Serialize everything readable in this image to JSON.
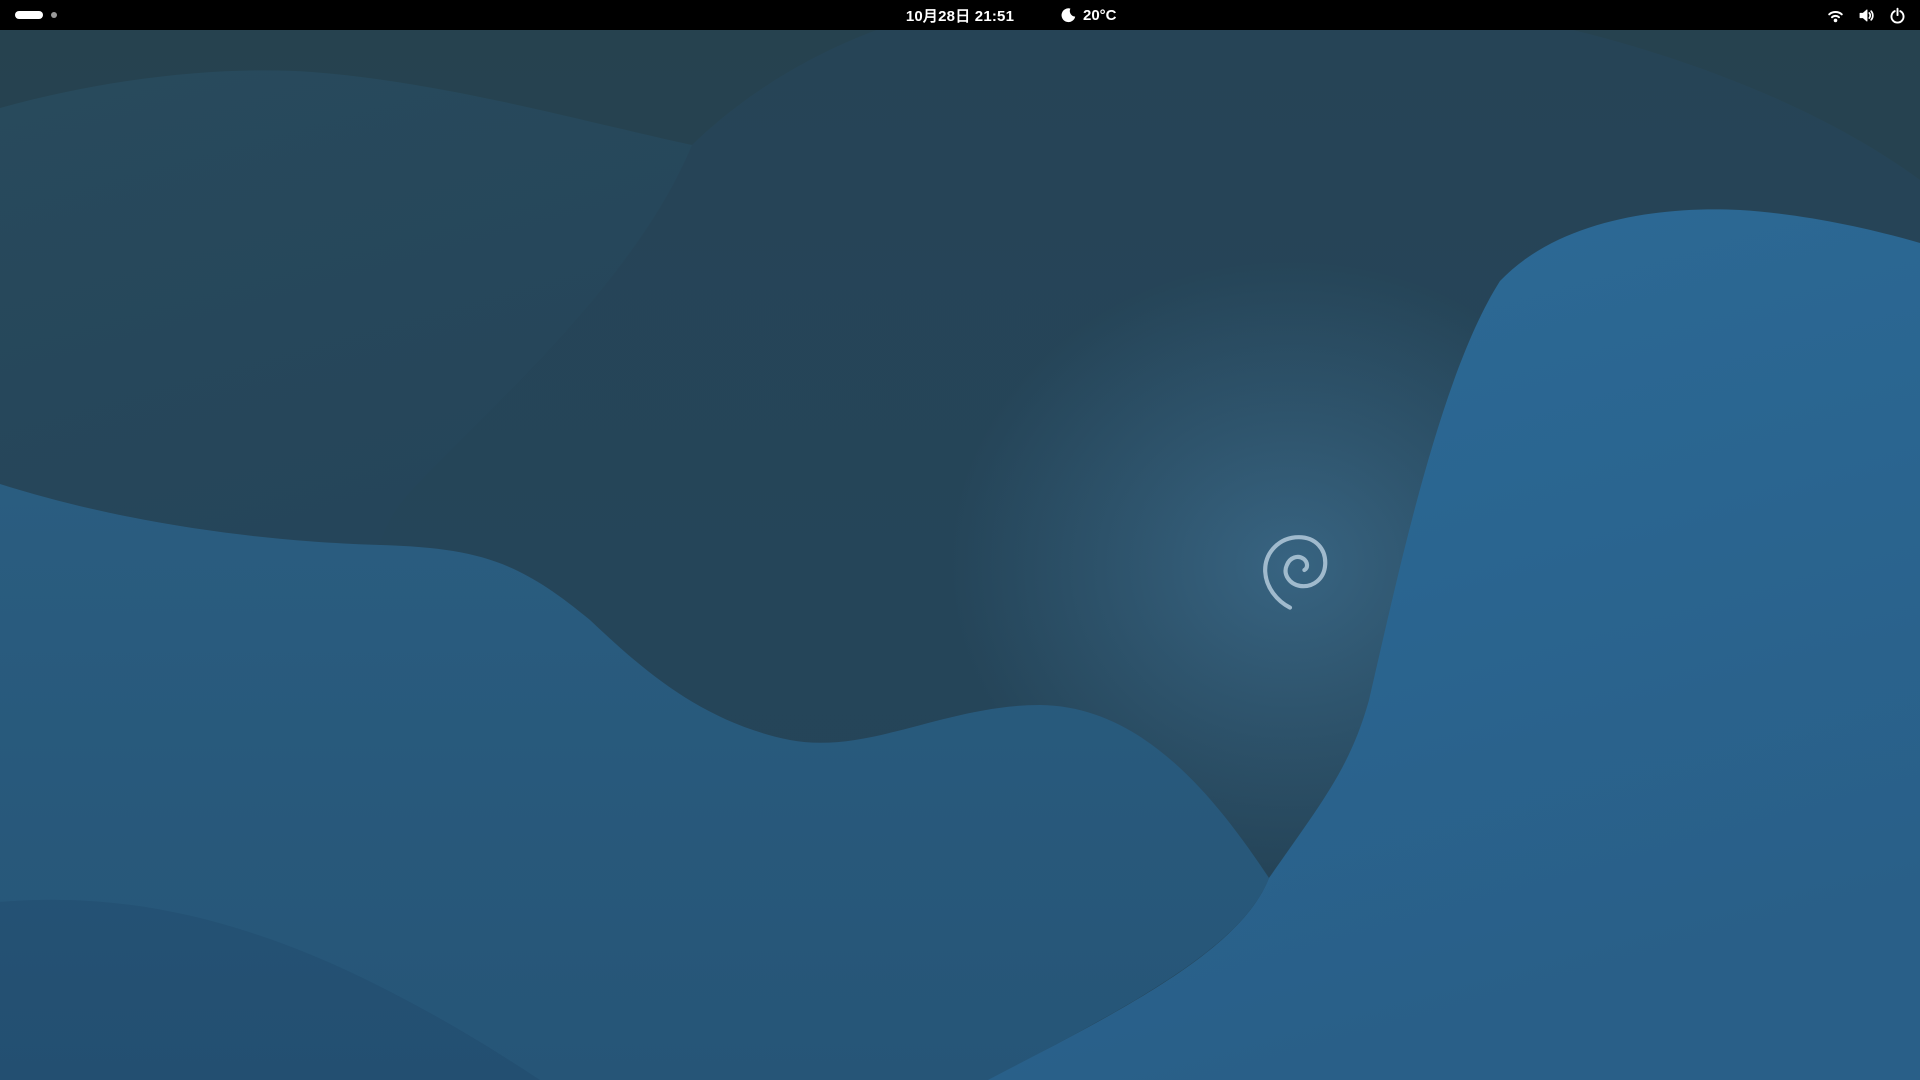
{
  "top_bar": {
    "workspace_indicator": {
      "total_workspaces": 2,
      "active_workspace": 1
    },
    "clock_label": "10月28日 21:51",
    "weather": {
      "icon": "moon-icon",
      "temperature": "20°C"
    },
    "system_menu": {
      "icons": [
        "wifi-icon",
        "volume-icon",
        "power-icon"
      ]
    },
    "background_color": "#000000",
    "foreground_color": "#ffffff"
  },
  "desktop": {
    "wallpaper": {
      "logo": "debian-swirl-logo",
      "palette": {
        "base_top": "#25414f",
        "dune_dark": "#26475a",
        "dome_slate": "#264456",
        "mid_band": "#254559",
        "wave_left_bright": "#275a7c",
        "wave_right_bright": "#2a6590",
        "glow_center": "#34617e",
        "logo_color": "#a9c2d4"
      }
    }
  }
}
